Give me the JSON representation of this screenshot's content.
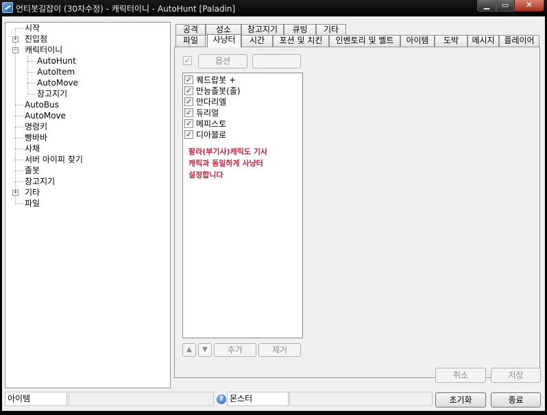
{
  "window": {
    "title": "언티봇길잡이 (30차수정) - 캐릭터이니 - AutoHunt [Paladin]",
    "icon": "app-icon",
    "minimize_icon": "minimize-icon",
    "maximize_icon": "maximize-icon",
    "close_icon": "close-icon"
  },
  "tree": {
    "items": [
      {
        "label": "시작"
      },
      {
        "label": "진입점",
        "expander": "+"
      },
      {
        "label": "캐릭터이니",
        "expander": "−"
      },
      {
        "label": "AutoHunt"
      },
      {
        "label": "AutoItem"
      },
      {
        "label": "AutoMove"
      },
      {
        "label": "창고지기"
      },
      {
        "label": "AutoBus"
      },
      {
        "label": "AutoMove"
      },
      {
        "label": "명령키"
      },
      {
        "label": "빵바바"
      },
      {
        "label": "사채"
      },
      {
        "label": "서버 아이피 찾기"
      },
      {
        "label": "졸봇"
      },
      {
        "label": "창고지기"
      },
      {
        "label": "기타",
        "expander": "+"
      },
      {
        "label": "파일"
      }
    ]
  },
  "tabs": {
    "row_top": [
      "공격",
      "성소",
      "창고지기",
      "큐빙",
      "기타"
    ],
    "row_bottom": [
      "파일",
      "사냥터",
      "시간",
      "포션 및 치킨",
      "인벤토리 및 벨트",
      "아이템",
      "도박",
      "메시지",
      "플레이어"
    ],
    "active": "사냥터"
  },
  "hunt": {
    "option_button": "옵션",
    "list": [
      {
        "label": "퀘드랍봇 +",
        "checked": true
      },
      {
        "label": "만능졸봇(졸)",
        "checked": true
      },
      {
        "label": "안다리엘",
        "checked": true
      },
      {
        "label": "듀리얼",
        "checked": true
      },
      {
        "label": "메피스토",
        "checked": true
      },
      {
        "label": "디아블로",
        "checked": true
      }
    ],
    "note": [
      "팔라(부기사)캐릭도 기사",
      "캐릭과 동일하게 사냥터",
      "설정합니다"
    ],
    "up_icon": "arrow-up-icon",
    "down_icon": "arrow-down-icon",
    "add_button": "추가",
    "remove_button": "제거"
  },
  "dialog": {
    "cancel_button": "취소",
    "save_button": "저장",
    "reset_button": "초기화",
    "close_button": "종료"
  },
  "status": {
    "item_label": "아이템",
    "help_icon": "help-icon",
    "monster_label": "몬스터"
  }
}
